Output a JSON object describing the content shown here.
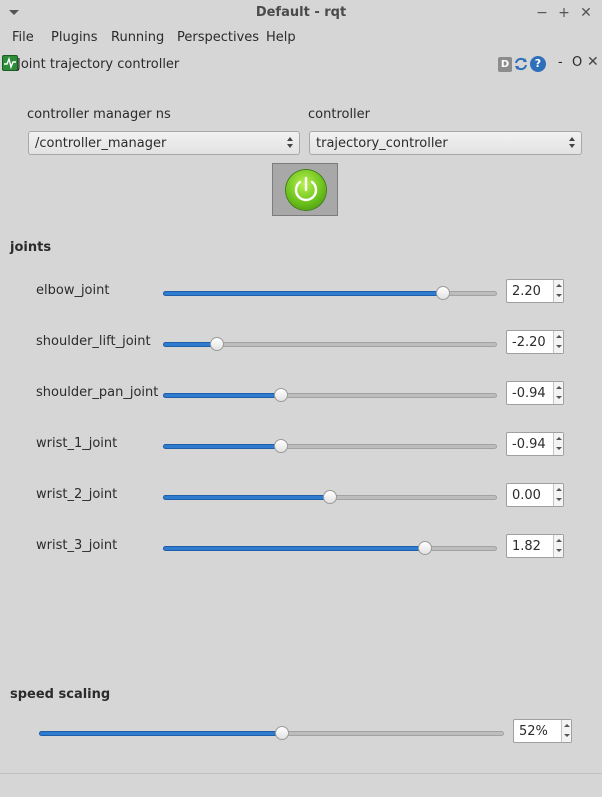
{
  "window": {
    "title": "Default - rqt",
    "controls": {
      "minimize": "−",
      "maximize": "+",
      "close": "✕"
    }
  },
  "menu": [
    {
      "label": "File"
    },
    {
      "label": "Plugins"
    },
    {
      "label": "Running"
    },
    {
      "label": "Perspectives"
    },
    {
      "label": "Help"
    }
  ],
  "dock": {
    "title": "Joint trajectory controller",
    "d_label": "D",
    "help_label": "?",
    "minimize_label": "-",
    "float_label": "O",
    "close_label": "✕"
  },
  "controller_manager": {
    "label": "controller manager ns",
    "value": "/controller_manager"
  },
  "controller": {
    "label": "controller",
    "value": "trajectory_controller"
  },
  "power_button": {
    "icon": "power-icon",
    "state": "on",
    "color": "#6cc21c"
  },
  "joints": {
    "title": "joints",
    "items": [
      {
        "name": "elbow_joint",
        "value": "2.20",
        "fraction": 0.835
      },
      {
        "name": "shoulder_lift_joint",
        "value": "-2.20",
        "fraction": 0.16
      },
      {
        "name": "shoulder_pan_joint",
        "value": "-0.94",
        "fraction": 0.35
      },
      {
        "name": "wrist_1_joint",
        "value": "-0.94",
        "fraction": 0.35
      },
      {
        "name": "wrist_2_joint",
        "value": "0.00",
        "fraction": 0.498
      },
      {
        "name": "wrist_3_joint",
        "value": "1.82",
        "fraction": 0.78
      }
    ]
  },
  "speed_scaling": {
    "title": "speed scaling",
    "value": "52%",
    "fraction": 0.52
  },
  "colors": {
    "accent": "#2f7bd0",
    "background": "#d6d6d6"
  }
}
